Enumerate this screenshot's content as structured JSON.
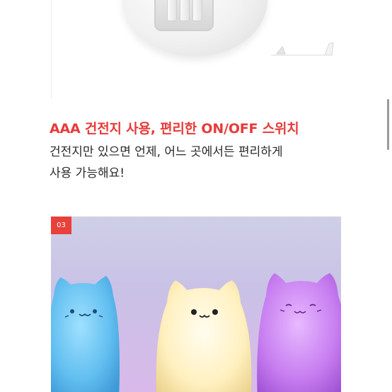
{
  "feature": {
    "title": "AAA 건전지 사용, 편리한 ON/OFF 스위치",
    "description_line1": "건전지만 있으면 언제, 어느 곳에서든 편리하게",
    "description_line2": "사용 가능해요!"
  },
  "gallery": {
    "step_badge": "03"
  },
  "colors": {
    "accent": "#e83a3a",
    "badge": "#e8403a",
    "text": "#2a2a2a",
    "lamp_blue": "#6fc7f2",
    "lamp_yellow": "#fff1c4",
    "lamp_purple": "#c77df0"
  },
  "icons": {
    "scroll": "scrollbar-thumb"
  }
}
